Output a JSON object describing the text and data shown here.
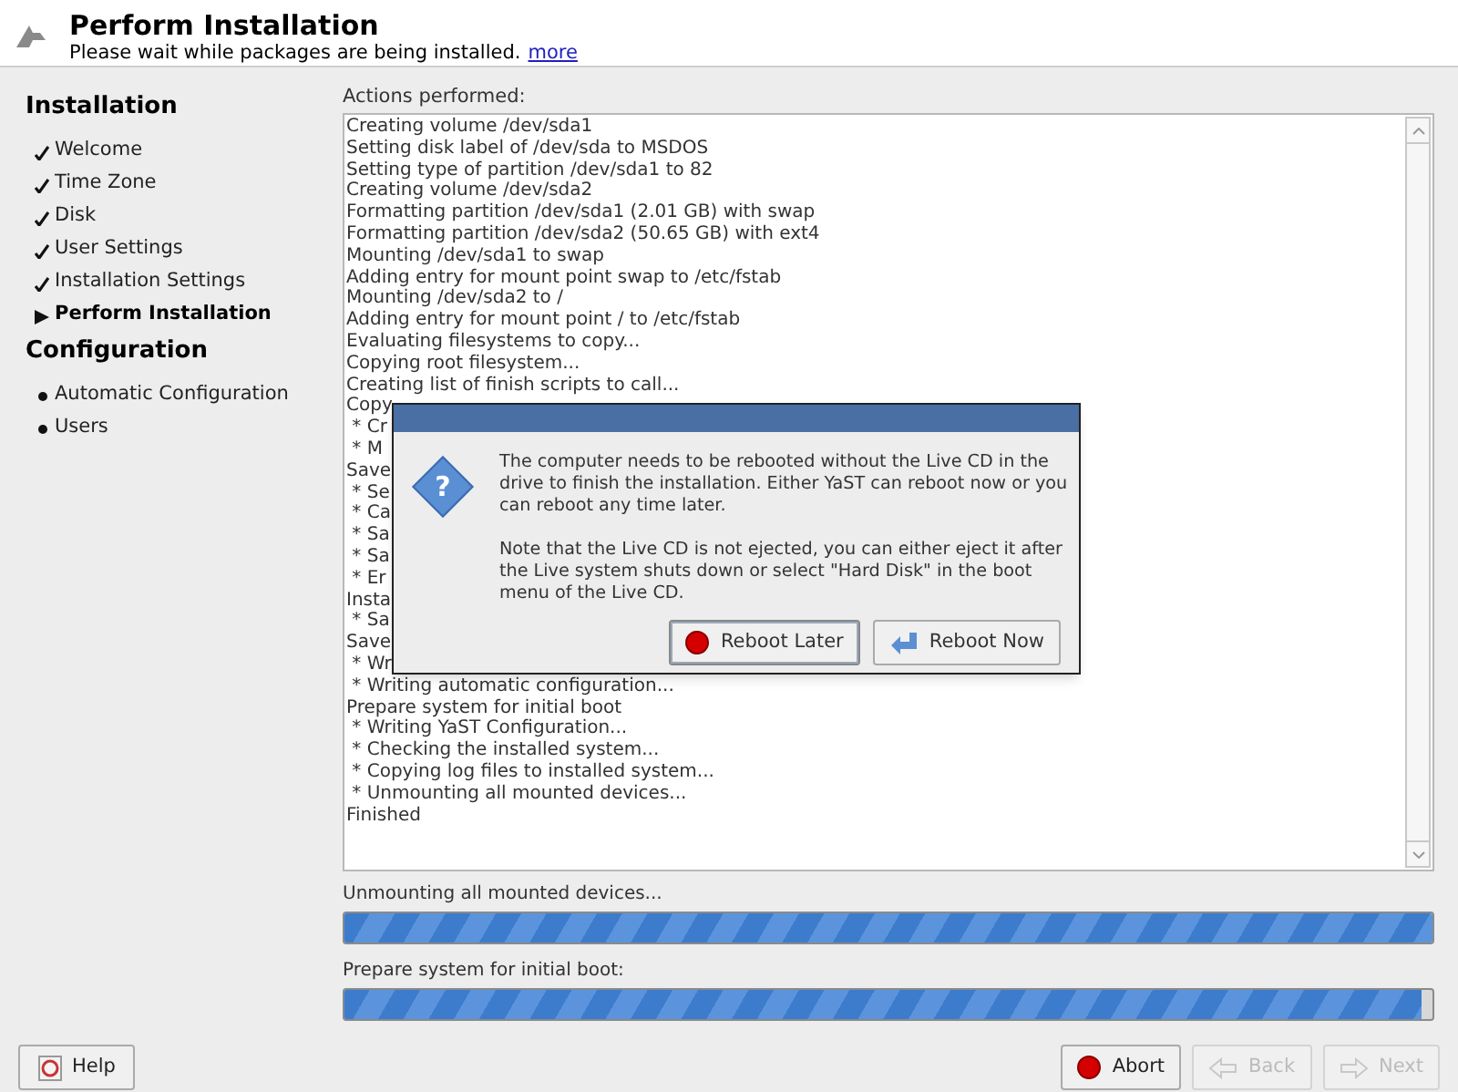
{
  "header": {
    "title": "Perform Installation",
    "subtitle": "Please wait while packages are being installed.",
    "link": "more"
  },
  "sidebar": [
    {
      "title": "Installation",
      "items": [
        {
          "label": "Welcome",
          "kind": "done"
        },
        {
          "label": "Time Zone",
          "kind": "done"
        },
        {
          "label": "Disk",
          "kind": "done"
        },
        {
          "label": "User Settings",
          "kind": "done"
        },
        {
          "label": "Installation Settings",
          "kind": "done"
        },
        {
          "label": "Perform Installation",
          "kind": "current"
        }
      ]
    },
    {
      "title": "Configuration",
      "items": [
        {
          "label": "Automatic Configuration",
          "kind": "pending"
        },
        {
          "label": "Users",
          "kind": "pending"
        }
      ]
    }
  ],
  "log": {
    "label": "Actions performed:",
    "lines": [
      "Creating volume /dev/sda1",
      "Setting disk label of /dev/sda to MSDOS",
      "Setting type of partition /dev/sda1 to 82",
      "Creating volume /dev/sda2",
      "Formatting partition /dev/sda1 (2.01 GB) with swap",
      "Formatting partition /dev/sda2 (50.65 GB) with ext4",
      "Mounting /dev/sda1 to swap",
      "Adding entry for mount point swap to /etc/fstab",
      "Mounting /dev/sda2 to /",
      "Adding entry for mount point / to /etc/fstab",
      "Evaluating filesystems to copy...",
      "Copying root filesystem...",
      "Creating list of finish scripts to call...",
      "Copy",
      " * Cr",
      " * M",
      "Save",
      " * Se",
      " * Ca",
      " * Sa",
      " * Sa",
      " * Er",
      "Insta",
      " * Sa",
      "Save",
      " * Wr",
      " * Writing automatic configuration...",
      "Prepare system for initial boot",
      " * Writing YaST Configuration...",
      " * Checking the installed system...",
      " * Copying log files to installed system...",
      " * Unmounting all mounted devices...",
      "Finished"
    ]
  },
  "progress": [
    {
      "label": "Unmounting all mounted devices...",
      "level": 1
    },
    {
      "label": "Prepare system for initial boot:",
      "level": 0.99
    }
  ],
  "dialog": {
    "paragraphs": [
      "The computer needs to be rebooted without the Live CD in the drive to finish the installation. Either YaST can reboot now or you can reboot any time later.",
      "Note that the Live CD is not ejected, you can either eject it after the Live system shuts down or select \"Hard Disk\" in the boot menu of the Live CD."
    ],
    "icon_glyph": "?",
    "buttons": [
      {
        "label": "Reboot Later",
        "kind": "stop",
        "selected": true
      },
      {
        "label": "Reboot Now",
        "kind": "go",
        "selected": false
      }
    ]
  },
  "footer": {
    "left": [
      {
        "label": "Help",
        "kind": "help",
        "disabled": false
      }
    ],
    "right": [
      {
        "label": "Abort",
        "kind": "stop",
        "disabled": false
      },
      {
        "label": "Back",
        "kind": "back",
        "disabled": true
      },
      {
        "label": "Next",
        "kind": "next",
        "disabled": true
      }
    ]
  }
}
